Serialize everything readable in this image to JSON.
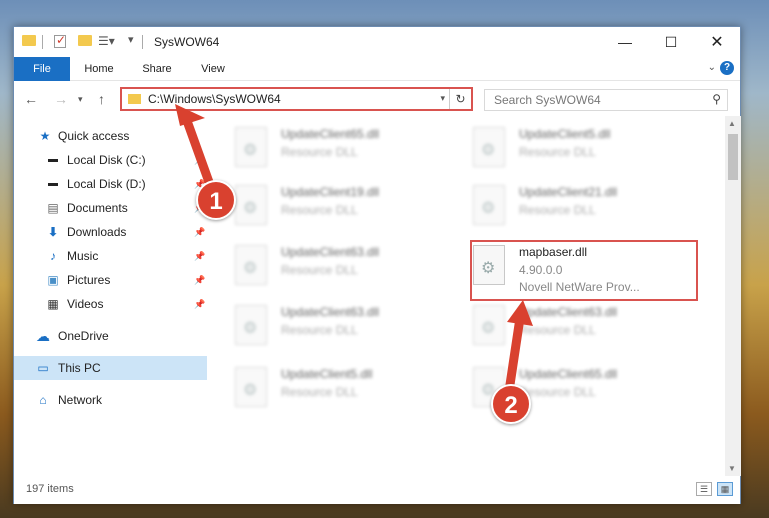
{
  "window": {
    "title": "SysWOW64"
  },
  "ribbon": {
    "tabs": [
      "File",
      "Home",
      "Share",
      "View"
    ],
    "help_label": "?"
  },
  "nav": {
    "address": "C:\\Windows\\SysWOW64",
    "search_placeholder": "Search SysWOW64"
  },
  "sidebar": {
    "items": [
      {
        "label": "Quick access",
        "icon": "star-icon"
      },
      {
        "label": "Local Disk (C:)",
        "icon": "drive-icon"
      },
      {
        "label": "Local Disk (D:)",
        "icon": "drive-icon"
      },
      {
        "label": "Documents",
        "icon": "document-icon"
      },
      {
        "label": "Downloads",
        "icon": "download-icon"
      },
      {
        "label": "Music",
        "icon": "music-icon"
      },
      {
        "label": "Pictures",
        "icon": "picture-icon"
      },
      {
        "label": "Videos",
        "icon": "video-icon"
      },
      {
        "label": "OneDrive",
        "icon": "cloud-icon"
      },
      {
        "label": "This PC",
        "icon": "computer-icon"
      },
      {
        "label": "Network",
        "icon": "network-icon"
      }
    ]
  },
  "files": [
    {
      "name": "UpdateClient65.dll",
      "line1": "Resource DLL",
      "line2": ""
    },
    {
      "name": "UpdateClient5.dll",
      "line1": "Resource DLL",
      "line2": ""
    },
    {
      "name": "UpdateClient19.dll",
      "line1": "Resource DLL",
      "line2": ""
    },
    {
      "name": "UpdateClient21.dll",
      "line1": "Resource DLL",
      "line2": ""
    },
    {
      "name": "UpdateClient63.dll",
      "line1": "Resource DLL",
      "line2": ""
    },
    {
      "name": "mapbaser.dll",
      "line1": "4.90.0.0",
      "line2": "Novell NetWare Prov..."
    },
    {
      "name": "UpdateClient63.dll",
      "line1": "Resource DLL",
      "line2": ""
    },
    {
      "name": "UpdateClient63.dll",
      "line1": "Resource DLL",
      "line2": ""
    },
    {
      "name": "UpdateClient5.dll",
      "line1": "Resource DLL",
      "line2": ""
    },
    {
      "name": "UpdateClient65.dll",
      "line1": "Resource DLL",
      "line2": ""
    }
  ],
  "status": {
    "item_count": "197 items"
  },
  "annotations": {
    "badge1": "1",
    "badge2": "2"
  },
  "colors": {
    "accent": "#1a6fc4",
    "highlight": "#d9534f",
    "badge": "#d9412f"
  }
}
